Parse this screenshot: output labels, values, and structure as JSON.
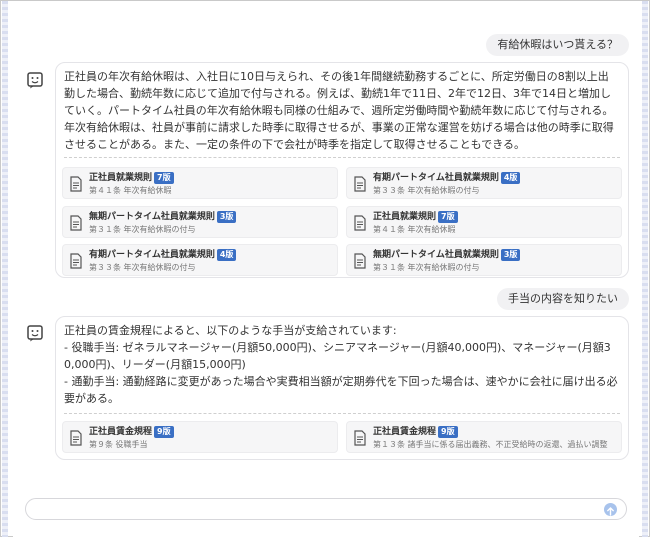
{
  "messages": [
    {
      "user": "有給休暇はいつ貰える？",
      "answer": "正社員の年次有給休暇は、入社日に10日与えられ、その後1年間継続勤務するごとに、所定労働日の8割以上出勤した場合、勤続年数に応じて追加で付与される。例えば、勤続1年で11日、2年で12日、3年で14日と増加していく。パートタイム社員の年次有給休暇も同様の仕組みで、週所定労働時間や勤続年数に応じて付与される。年次有給休暇は、社員が事前に請求した時季に取得させるが、事業の正常な運営を妨げる場合は他の時季に取得させることがある。また、一定の条件の下で会社が時季を指定して取得させることもできる。",
      "refs": [
        {
          "title": "正社員就業規則",
          "version": "7版",
          "detail": "第４１条 年次有給休暇"
        },
        {
          "title": "有期パートタイム社員就業規則",
          "version": "4版",
          "detail": "第３３条 年次有給休暇の付与"
        },
        {
          "title": "無期パートタイム社員就業規則",
          "version": "3版",
          "detail": "第３１条 年次有給休暇の付与"
        },
        {
          "title": "正社員就業規則",
          "version": "7版",
          "detail": "第４１条 年次有給休暇"
        },
        {
          "title": "有期パートタイム社員就業規則",
          "version": "4版",
          "detail": "第３３条 年次有給休暇の付与"
        },
        {
          "title": "無期パートタイム社員就業規則",
          "version": "3版",
          "detail": "第３１条 年次有給休暇の付与"
        }
      ]
    },
    {
      "user": "手当の内容を知りたい",
      "answer": "正社員の賃金規程によると、以下のような手当が支給されています:\n- 役職手当: ゼネラルマネージャー(月額50,000円)、シニアマネージャー(月額40,000円)、マネージャー(月額30,000円)、リーダー(月額15,000円)\n- 通勤手当: 通勤経路に変更があった場合や実費相当額が定期券代を下回った場合は、速やかに会社に届け出る必要がある。",
      "refs": [
        {
          "title": "正社員賃金規程",
          "version": "9版",
          "detail": "第９条 役職手当"
        },
        {
          "title": "正社員賃金規程",
          "version": "9版",
          "detail": "第１３条 諸手当に係る届出義務、不正受給時の返還、過払い調整"
        }
      ]
    }
  ],
  "input": {
    "placeholder": ""
  },
  "icons": {
    "assistant": "bot-face-icon",
    "reference": "document-icon",
    "send": "send-arrow-icon"
  },
  "colors": {
    "badge": "#3a6fc4",
    "send": "#a8c3ec"
  }
}
